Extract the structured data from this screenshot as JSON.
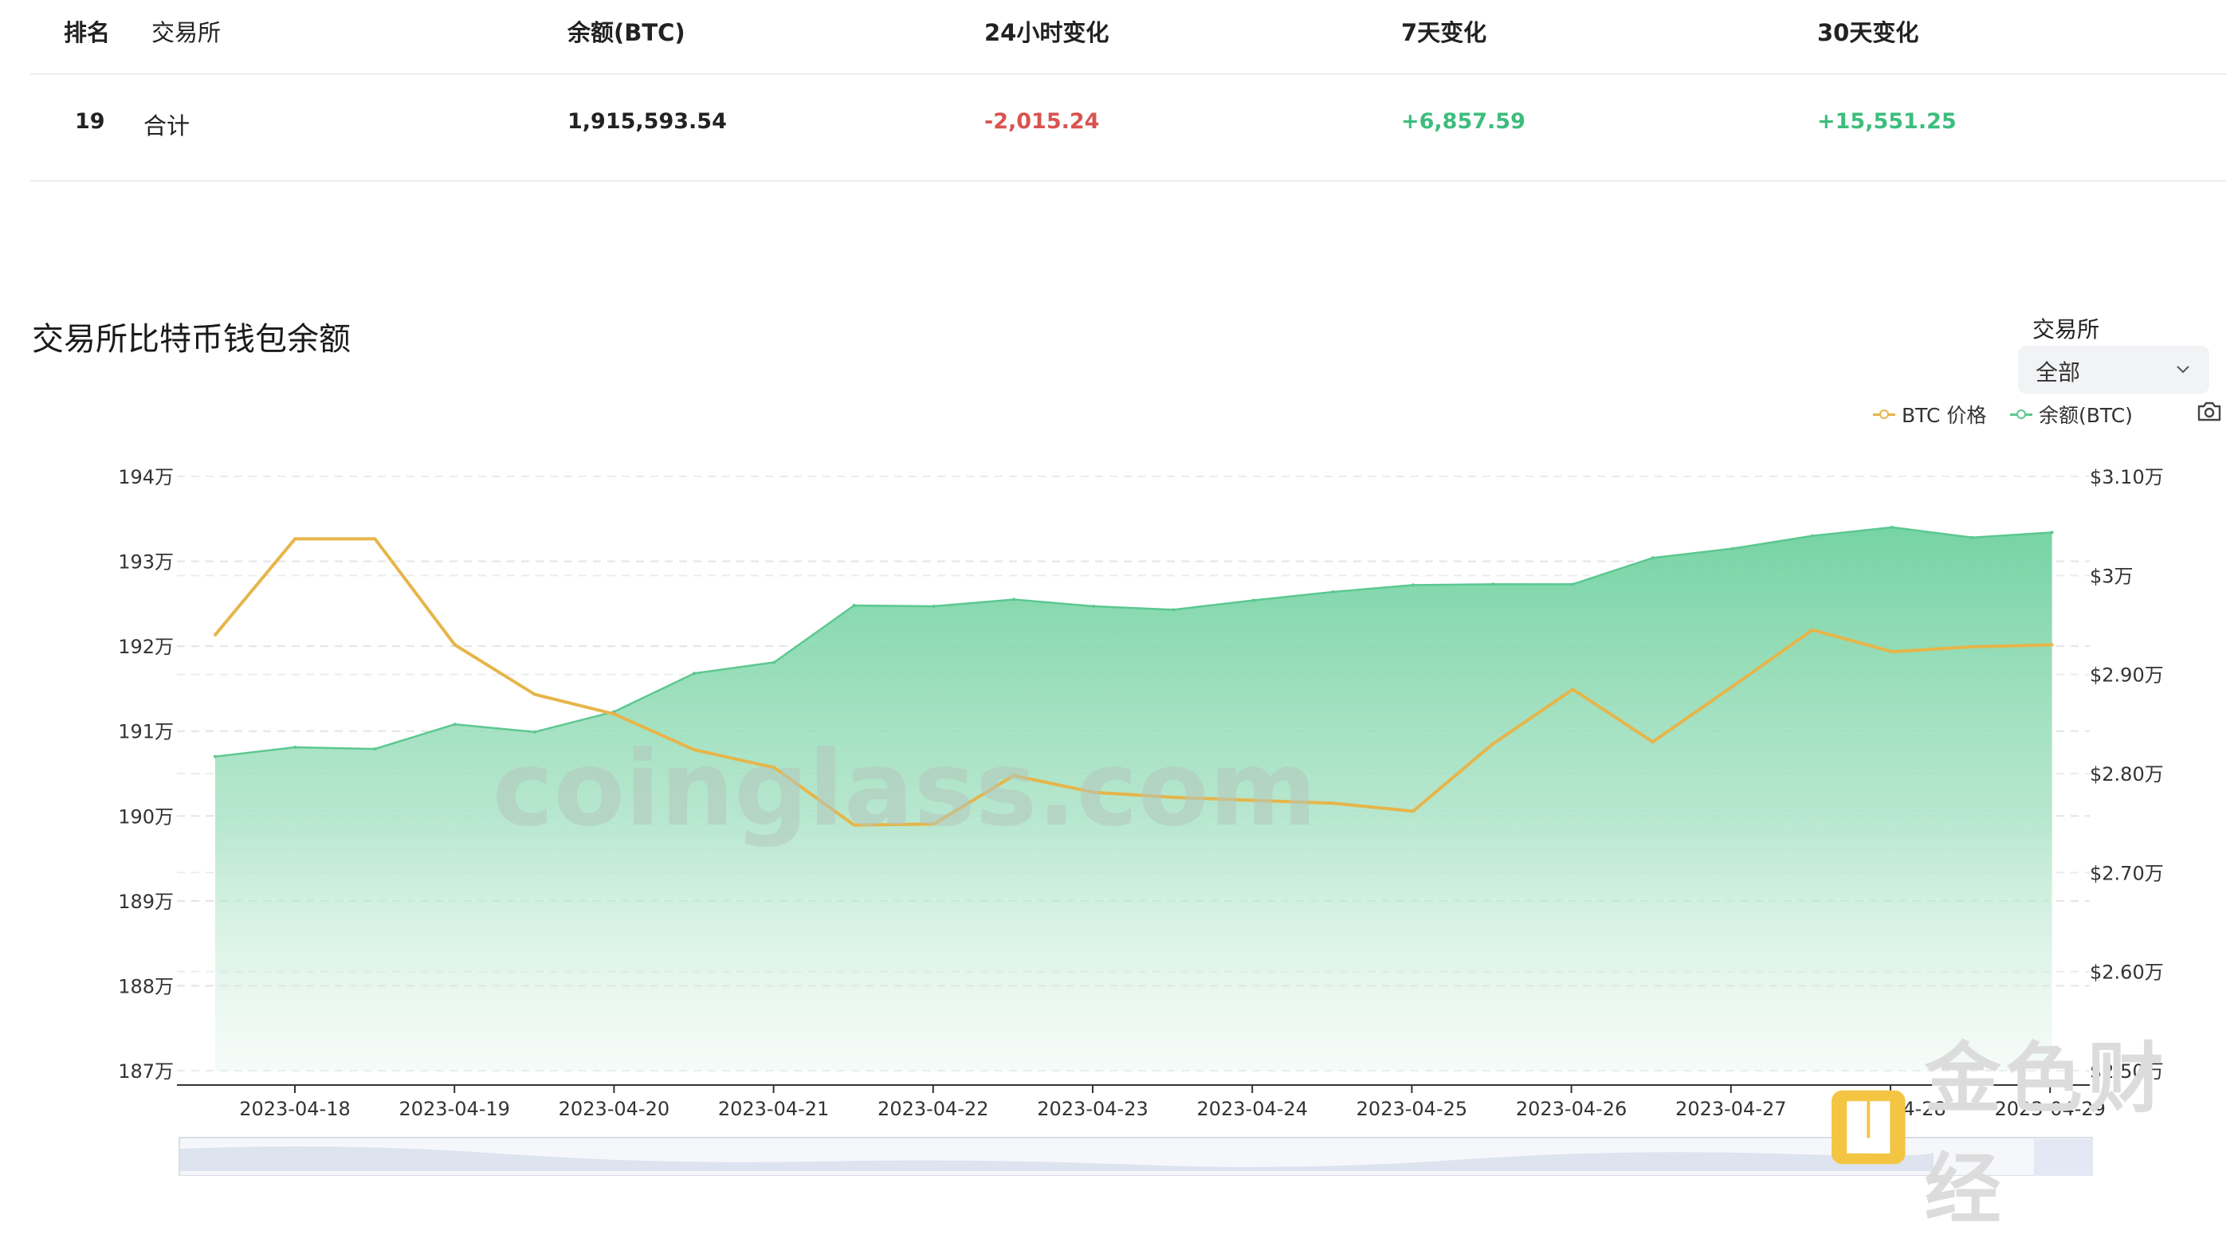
{
  "table": {
    "headers": [
      "排名",
      "交易所",
      "余额(BTC)",
      "24小时变化",
      "7天变化",
      "30天变化"
    ],
    "row": {
      "rank": "19",
      "exchange": "合计",
      "balance": "1,915,593.54",
      "change_24h": "-2,015.24",
      "change_7d": "+6,857.59",
      "change_30d": "+15,551.25"
    }
  },
  "section": {
    "title": "交易所比特币钱包余额",
    "filter_label": "交易所",
    "filter_value": "全部"
  },
  "colors": {
    "price_line": "#e6b54a",
    "balance_line": "#5cc890",
    "negative": "#d9534f",
    "positive": "#3dbd7d"
  },
  "icons": [
    "chevron-down-icon",
    "camera-icon",
    "brand-logo-icon"
  ],
  "watermark": "coinglass.com",
  "brand_text": "金色财经",
  "chart_data": {
    "type": "line",
    "x": [
      "2023-04-17",
      "2023-04-18",
      "2023-04-18",
      "2023-04-19",
      "2023-04-19",
      "2023-04-20",
      "2023-04-20",
      "2023-04-21",
      "2023-04-21",
      "2023-04-22",
      "2023-04-22",
      "2023-04-23",
      "2023-04-23",
      "2023-04-24",
      "2023-04-24",
      "2023-04-25",
      "2023-04-25",
      "2023-04-26",
      "2023-04-26",
      "2023-04-27",
      "2023-04-27",
      "2023-04-28",
      "2023-04-28",
      "2023-04-29"
    ],
    "x_ticks": [
      "2023-04-18",
      "2023-04-19",
      "2023-04-20",
      "2023-04-21",
      "2023-04-22",
      "2023-04-23",
      "2023-04-24",
      "2023-04-25",
      "2023-04-26",
      "2023-04-27",
      "2023-04-28",
      "2023-04-29"
    ],
    "series": [
      {
        "name": "余额(BTC)",
        "axis": "left",
        "style": "area",
        "values": [
          1907000,
          1908100,
          1907900,
          1910800,
          1909900,
          1912300,
          1916800,
          1918100,
          1924800,
          1924700,
          1925500,
          1924700,
          1924300,
          1925400,
          1926400,
          1927200,
          1927300,
          1927300,
          1930400,
          1931500,
          1933000,
          1934000,
          1932800,
          1933400
        ]
      },
      {
        "name": "BTC 价格",
        "axis": "right",
        "style": "line",
        "values": [
          29400,
          30370,
          30370,
          29300,
          28800,
          28600,
          28240,
          28060,
          27480,
          27490,
          27980,
          27810,
          27760,
          27730,
          27700,
          27620,
          28300,
          28850,
          28320,
          28880,
          29450,
          29230,
          29280,
          29300
        ]
      }
    ],
    "y_left": {
      "min": 1870000,
      "max": 1940000,
      "ticks": [
        1940000,
        1930000,
        1920000,
        1910000,
        1900000,
        1890000,
        1880000,
        1870000
      ],
      "tick_labels": [
        "194万",
        "193万",
        "192万",
        "191万",
        "190万",
        "189万",
        "188万",
        "187万"
      ]
    },
    "y_right": {
      "min": 25000,
      "max": 31000,
      "ticks": [
        31000,
        30000,
        29000,
        28000,
        27000,
        26000,
        25000
      ],
      "tick_labels": [
        "$3.10万",
        "$3万",
        "$2.90万",
        "$2.80万",
        "$2.70万",
        "$2.60万",
        "$2.50万"
      ]
    },
    "grid": true,
    "legend_position": "top-right"
  }
}
